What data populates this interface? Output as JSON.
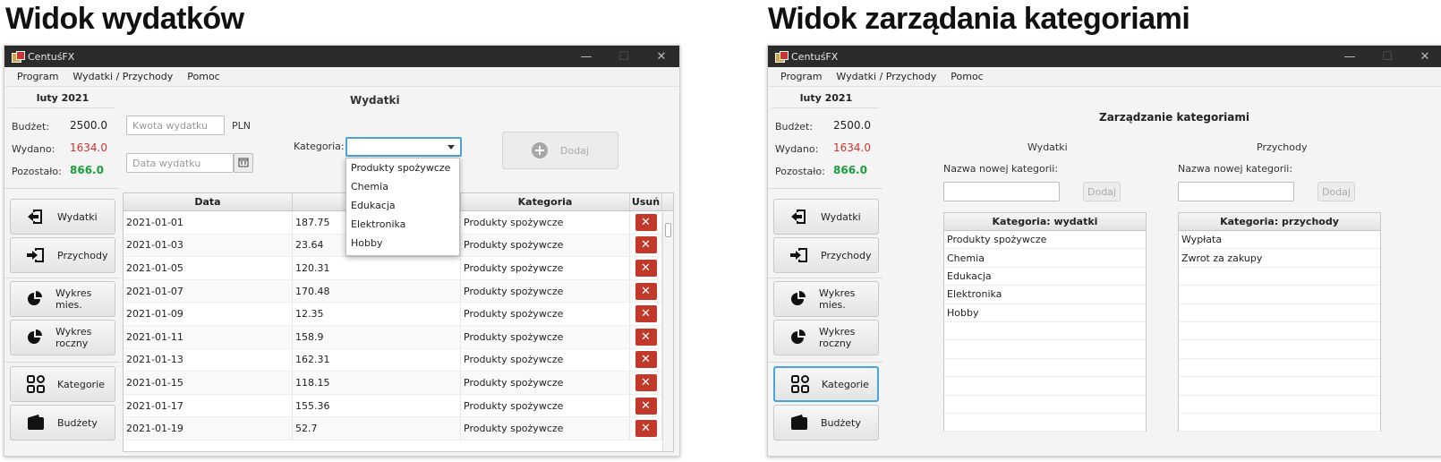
{
  "headings": {
    "left": "Widok wydatków",
    "right": "Widok zarządania kategoriami"
  },
  "app": {
    "title": "CentuśFX",
    "minimize": "—",
    "maximize": "☐",
    "close": "✕"
  },
  "menu": [
    "Program",
    "Wydatki / Przychody",
    "Pomoc"
  ],
  "sidebar": {
    "month": "luty 2021",
    "budget_label": "Budżet:",
    "budget_value": "2500.0",
    "spent_label": "Wydano:",
    "spent_value": "1634.0",
    "left_label": "Pozostało:",
    "left_value": "866.0",
    "nav": [
      "Wydatki",
      "Przychody",
      "Wykres mies.",
      "Wykres roczny",
      "Kategorie",
      "Budżety"
    ]
  },
  "expenses": {
    "title": "Wydatki",
    "amount_placeholder": "Kwota wydatku",
    "currency": "PLN",
    "date_placeholder": "Data wydatku",
    "category_label": "Kategoria:",
    "add_label": "Dodaj",
    "dropdown_options": [
      "Produkty spożywcze",
      "Chemia",
      "Edukacja",
      "Elektronika",
      "Hobby"
    ],
    "columns": [
      "Data",
      "",
      "Kategoria",
      "Usuń"
    ],
    "rows": [
      [
        "2021-01-01",
        "187.75",
        "Produkty spożywcze"
      ],
      [
        "2021-01-03",
        "23.64",
        "Produkty spożywcze"
      ],
      [
        "2021-01-05",
        "120.31",
        "Produkty spożywcze"
      ],
      [
        "2021-01-07",
        "170.48",
        "Produkty spożywcze"
      ],
      [
        "2021-01-09",
        "12.35",
        "Produkty spożywcze"
      ],
      [
        "2021-01-11",
        "158.9",
        "Produkty spożywcze"
      ],
      [
        "2021-01-13",
        "162.31",
        "Produkty spożywcze"
      ],
      [
        "2021-01-15",
        "118.15",
        "Produkty spożywcze"
      ],
      [
        "2021-01-17",
        "155.36",
        "Produkty spożywcze"
      ],
      [
        "2021-01-19",
        "52.7",
        "Produkty spożywcze"
      ]
    ]
  },
  "categories": {
    "title": "Zarządzanie kategoriami",
    "expense_col_title": "Wydatki",
    "income_col_title": "Przychody",
    "new_label": "Nazwa nowej kategorii:",
    "add_label": "Dodaj",
    "expense_header": "Kategoria: wydatki",
    "income_header": "Kategoria: przychody",
    "expense_items": [
      "Produkty spożywcze",
      "Chemia",
      "Edukacja",
      "Elektronika",
      "Hobby"
    ],
    "income_items": [
      "Wypłata",
      "Zwrot za zakupy"
    ]
  },
  "colors": {
    "spent": "#d0342c",
    "left": "#1a9e3a",
    "delete": "#c0392b",
    "active": "#4aa3df"
  }
}
